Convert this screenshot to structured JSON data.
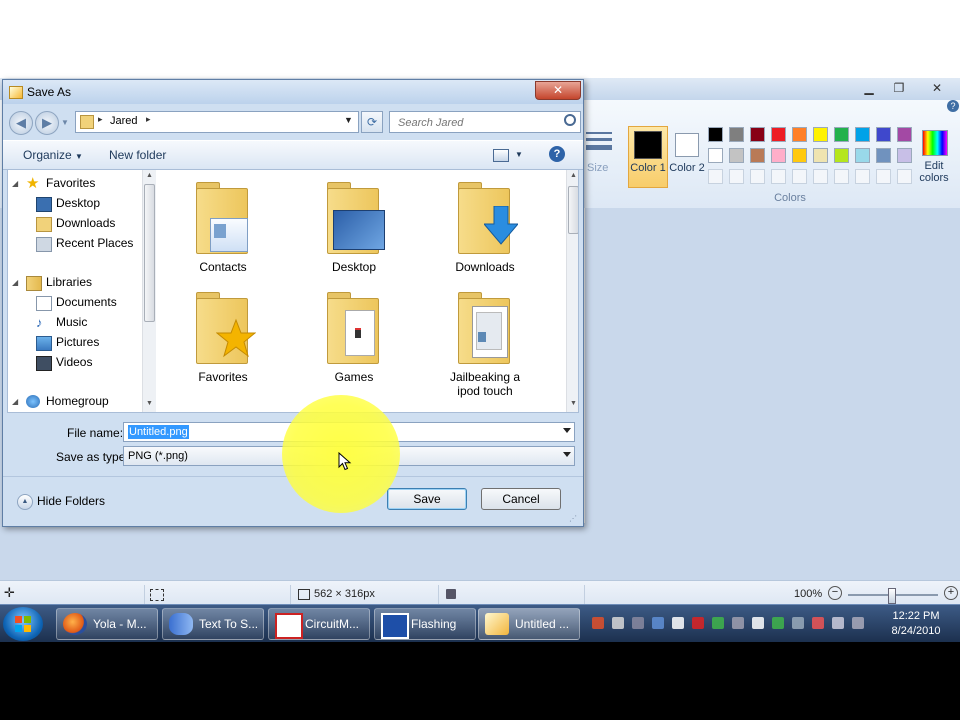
{
  "dialog": {
    "title": "Save As",
    "close_label": "✕",
    "address": {
      "segment": "Jared"
    },
    "search": {
      "placeholder": "Search Jared"
    },
    "toolbar": {
      "organize_label": "Organize",
      "new_folder_label": "New folder"
    },
    "nav": {
      "favorites": {
        "label": "Favorites",
        "items": [
          "Desktop",
          "Downloads",
          "Recent Places"
        ]
      },
      "libraries": {
        "label": "Libraries",
        "items": [
          "Documents",
          "Music",
          "Pictures",
          "Videos"
        ]
      },
      "homegroup": {
        "label": "Homegroup"
      }
    },
    "files": [
      "Contacts",
      "Desktop",
      "Downloads",
      "Favorites",
      "Games",
      "Jailbeaking a ipod touch"
    ],
    "file_name": {
      "label": "File name:",
      "value": "Untitled.png"
    },
    "save_as_type": {
      "label": "Save as type:",
      "value": "PNG (*.png)"
    },
    "hide_folders_label": "Hide Folders",
    "save_label": "Save",
    "cancel_label": "Cancel"
  },
  "paint": {
    "ribbon": {
      "size_label": "Size",
      "color1_label": "Color 1",
      "color2_label": "Color 2",
      "edit_colors_label": "Edit colors",
      "colors_group_label": "Colors",
      "palette_row1": [
        "#000000",
        "#7f7f7f",
        "#880015",
        "#ed1c24",
        "#ff7f27",
        "#fff200",
        "#22b14c",
        "#00a2e8",
        "#3f48cc",
        "#a349a4"
      ],
      "palette_row2": [
        "#ffffff",
        "#c3c3c3",
        "#b97a57",
        "#ffaec9",
        "#ffc90e",
        "#efe4b0",
        "#b5e61d",
        "#99d9ea",
        "#7092be",
        "#c8bfe7"
      ]
    },
    "status": {
      "dimensions": "562 × 316px",
      "zoom": "100%"
    }
  },
  "taskbar": {
    "tasks": [
      "Yola - M...",
      "Text To S...",
      "CircuitM...",
      "Flashing",
      "Untitled ..."
    ],
    "clock": {
      "time": "12:22 PM",
      "date": "8/24/2010"
    }
  },
  "colors": {
    "accent": "#3f6ea4",
    "dialog_bg": "#cfdff1",
    "folder": "#f1d27a",
    "highlight": "#ffff3c",
    "taskbar": "#1b2f4d"
  }
}
